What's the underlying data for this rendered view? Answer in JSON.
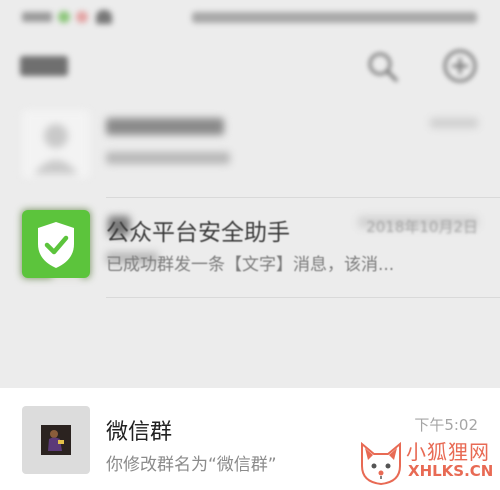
{
  "status_bar": {},
  "top_bar": {
    "icons": [
      "search-icon",
      "add-icon"
    ]
  },
  "chats": [
    {
      "avatar_icon": "contact-avatar",
      "unread_badge": false
    },
    {
      "avatar_icon": "photo-avatar"
    },
    {
      "avatar_icon": "shield-check-icon",
      "name": "公众平台安全助手",
      "time": "2018年10月2日",
      "message": "已成功群发一条【文字】消息，该消..."
    },
    {
      "avatar_icon": "group-avatar",
      "name": "微信群",
      "time": "下午5:02",
      "message": "你修改群名为“微信群”"
    }
  ],
  "watermark": {
    "name": "小狐狸网",
    "domain": "XHLKS.CN"
  },
  "colors": {
    "list_background": "#ececec",
    "highlight_background": "#ffffff",
    "shield_green": "#5cc43c",
    "watermark_orange": "#e86a54"
  }
}
